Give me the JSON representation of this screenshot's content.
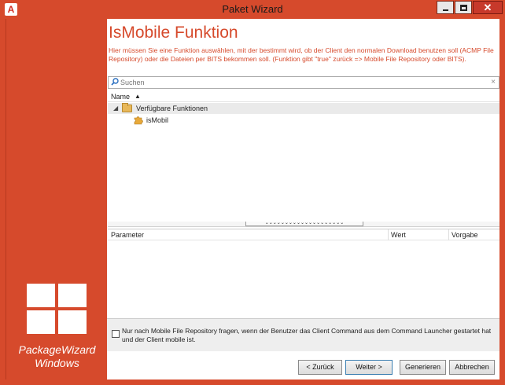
{
  "window": {
    "title": "Paket Wizard",
    "app_icon": "A",
    "close_label": "✕"
  },
  "brand": {
    "name_line1": "PackageWizard",
    "name_line2": "Windows"
  },
  "page": {
    "heading": "IsMobile Funktion",
    "description": "Hier müssen Sie eine Funktion auswählen, mit der bestimmt wird, ob der Client den normalen Download benutzen soll (ACMP File Repository) oder die Dateien per BITS bekommen soll. (Funktion gibt \"true\" zurück => Mobile File Repository oder BITS)."
  },
  "search": {
    "placeholder": "Suchen",
    "value": "",
    "clear": "×"
  },
  "tree": {
    "column_header": "Name",
    "sort_indicator": "▲",
    "expander": "◢",
    "items": [
      {
        "label": "Verfügbare Funktionen",
        "icon": "folder-icon"
      },
      {
        "label": "isMobil",
        "icon": "puzzle-icon"
      }
    ]
  },
  "splitter": {
    "grip": "⌄⌄⌄⌄⌄⌄⌄⌄⌄⌄⌄⌄⌄⌄⌄⌄⌄⌄⌄⌄"
  },
  "params": {
    "columns": [
      "Parameter",
      "Wert",
      "Vorgabe"
    ]
  },
  "option": {
    "checked": false,
    "label": "Nur nach Mobile File Repository fragen, wenn der Benutzer das Client Command aus dem Command Launcher gestartet hat und der Client mobile ist."
  },
  "buttons": {
    "back": "< Zurück",
    "next": "Weiter >",
    "generate": "Generieren",
    "cancel": "Abbrechen"
  },
  "colors": {
    "accent": "#d64a2c"
  }
}
